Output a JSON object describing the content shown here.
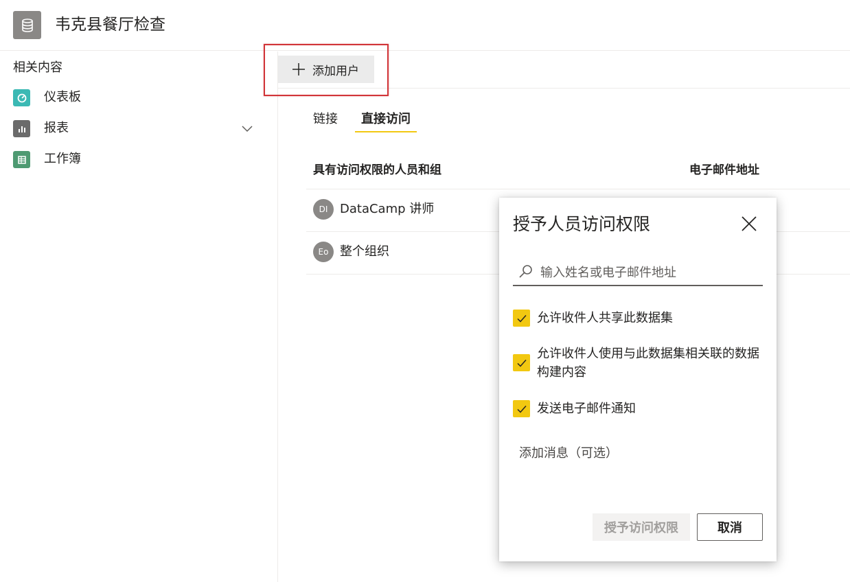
{
  "header": {
    "title": "韦克县餐厅检查",
    "icon": "database-icon"
  },
  "sidebar": {
    "heading": "相关内容",
    "items": [
      {
        "label": "仪表板",
        "icon": "dashboard-icon",
        "color": "#3bb9b4"
      },
      {
        "label": "报表",
        "icon": "report-icon",
        "color": "#6b6b6b"
      },
      {
        "label": "工作簿",
        "icon": "workbook-icon",
        "color": "#4e9a72"
      }
    ]
  },
  "toolbar": {
    "add_user_label": "添加用户"
  },
  "tabs": [
    {
      "label": "链接",
      "active": false
    },
    {
      "label": "直接访问",
      "active": true
    }
  ],
  "table": {
    "columns": [
      "具有访问权限的人员和组",
      "电子邮件地址"
    ],
    "rows": [
      {
        "initials": "DI",
        "name": "DataCamp 讲师"
      },
      {
        "initials": "Eo",
        "name": "整个组织"
      }
    ]
  },
  "dialog": {
    "title": "授予人员访问权限",
    "search_placeholder": "输入姓名或电子邮件地址",
    "checkboxes": [
      {
        "label": "允许收件人共享此数据集",
        "checked": true
      },
      {
        "label": "允许收件人使用与此数据集相关联的数据构建内容",
        "checked": true
      },
      {
        "label": "发送电子邮件通知",
        "checked": true
      }
    ],
    "message_label": "添加消息（可选）",
    "grant_button": "授予访问权限",
    "cancel_button": "取消"
  },
  "colors": {
    "accent": "#f2c811",
    "highlight": "#d13438"
  }
}
